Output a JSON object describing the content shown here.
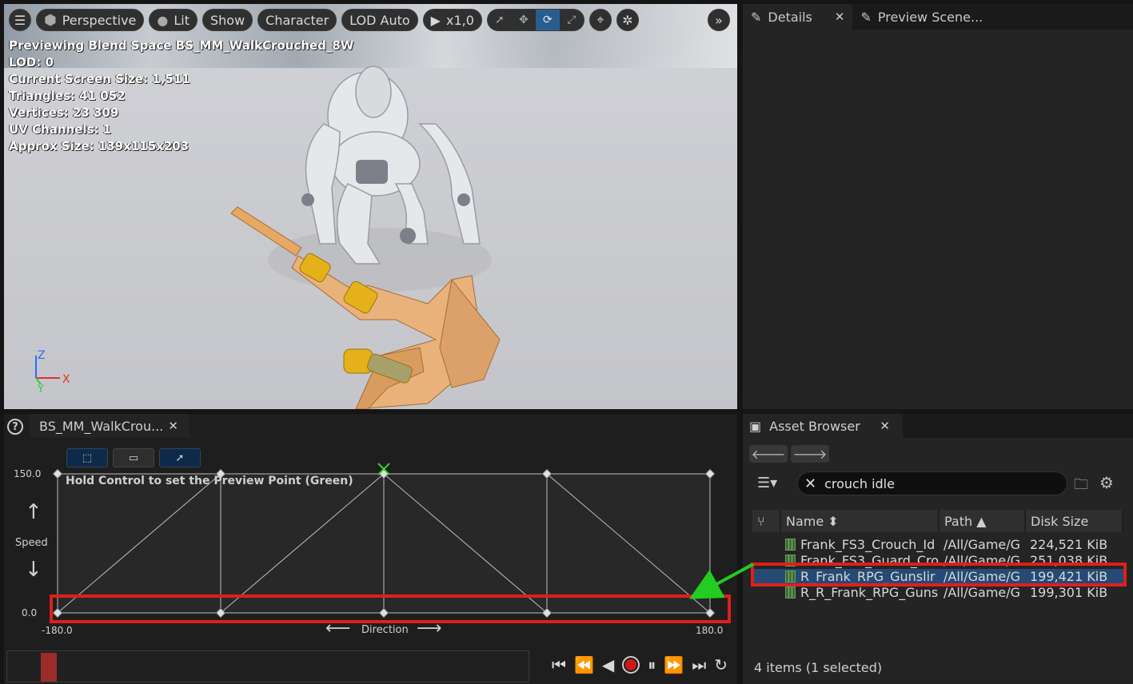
{
  "viewport": {
    "toolbar": {
      "perspective_label": "Perspective",
      "lit_label": "Lit",
      "show_label": "Show",
      "character_label": "Character",
      "lod_label": "LOD Auto",
      "play_rate_label": "x1,0"
    },
    "stats": [
      "Previewing Blend Space BS_MM_WalkCrouched_8W",
      "LOD: 0",
      "Current Screen Size: 1,511",
      "Triangles: 41 052",
      "Vertices: 23 309",
      "UV Channels: 1",
      "Approx Size: 139x115x203"
    ],
    "gizmo": {
      "z": "Z",
      "x": "X",
      "y": "Y"
    }
  },
  "details_panel": {
    "tabs": [
      {
        "label": "Details"
      },
      {
        "label": "Preview Scene..."
      }
    ]
  },
  "blend_space": {
    "tab_label": "BS_MM_WalkCrou...",
    "hint": "Hold Control to set the Preview Point (Green)",
    "y_axis": {
      "label": "Speed",
      "max": "150.0",
      "min": "0.0"
    },
    "x_axis": {
      "label": "Direction",
      "min": "-180.0",
      "max": "180.0"
    },
    "samples": {
      "top": [
        -180,
        -90,
        0,
        90,
        180
      ],
      "bottom": [
        -180,
        -90,
        0,
        90,
        180
      ]
    },
    "preview_point": {
      "direction": 0,
      "speed": 150
    }
  },
  "asset_browser": {
    "tab_label": "Asset Browser",
    "search_value": "crouch idle",
    "columns": [
      {
        "label": "Name ⬍"
      },
      {
        "label": "Path ▲"
      },
      {
        "label": "Disk Size"
      }
    ],
    "rows": [
      {
        "name": "Frank_FS3_Crouch_Id",
        "path": "/All/Game/G",
        "size": "224,521 KiB"
      },
      {
        "name": "Frank_FS3_Guard_Cro",
        "path": "/All/Game/G",
        "size": "251,038 KiB"
      },
      {
        "name": "R_Frank_RPG_Gunslir",
        "path": "/All/Game/G",
        "size": "199,421 KiB"
      },
      {
        "name": "R_R_Frank_RPG_Guns",
        "path": "/All/Game/G",
        "size": "199,301 KiB"
      }
    ],
    "selected_row": 2,
    "status": "4 items (1 selected)"
  },
  "colors": {
    "highlight": "#e01e1e",
    "arrow": "#22cc22",
    "selection": "#254a74"
  }
}
